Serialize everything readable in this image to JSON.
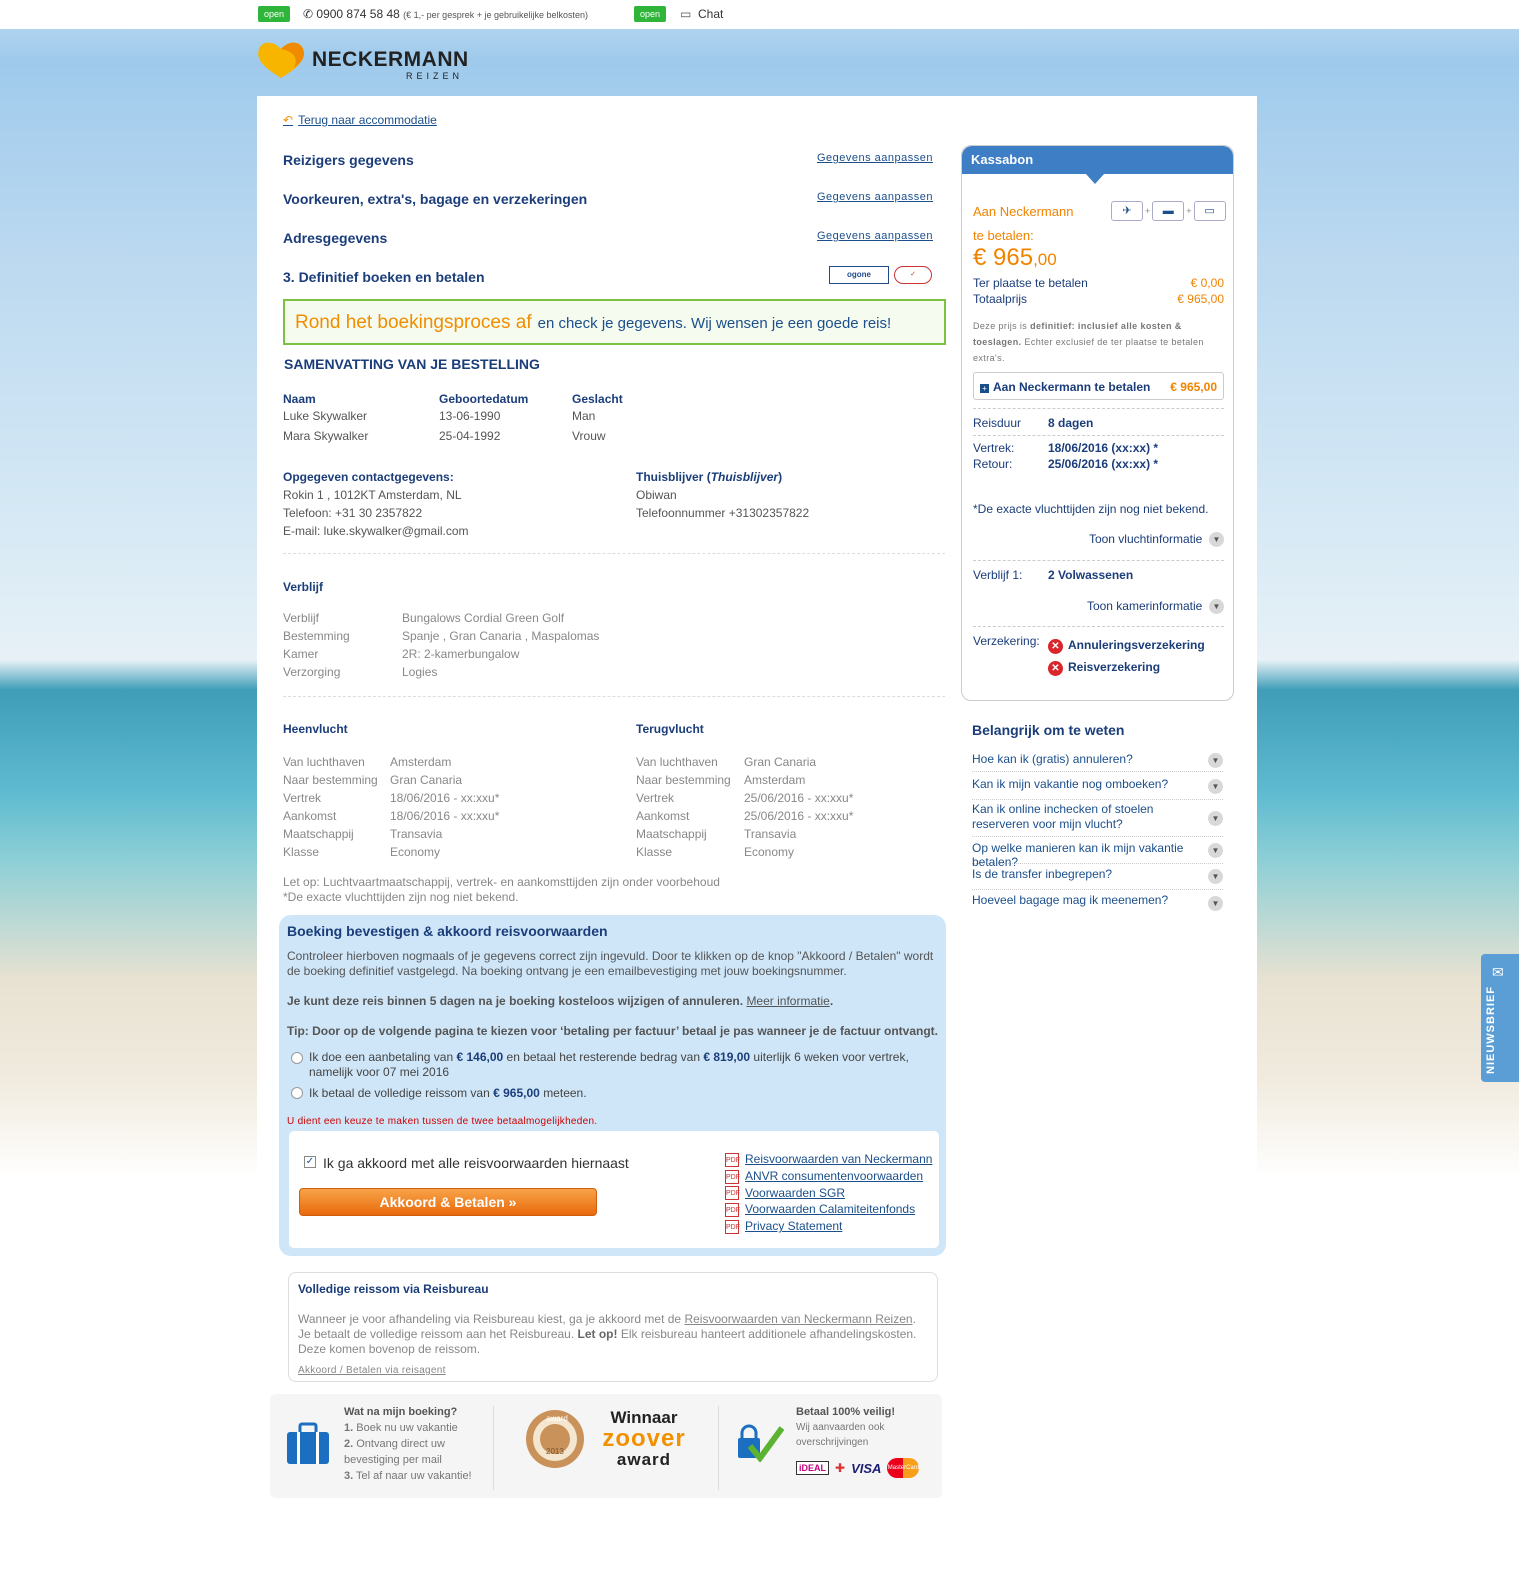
{
  "topbar": {
    "open1": "open",
    "phone": "0900 874 58 48",
    "phone_note": "(€ 1,- per gesprek + je gebruikelijke belkosten)",
    "open2": "open",
    "chat": "Chat"
  },
  "brand": {
    "name": "NECKERMANN",
    "sub": "REIZEN"
  },
  "back_link": "Terug naar accommodatie",
  "steps": [
    {
      "title": "Reizigers gegevens",
      "edit": "Gegevens aanpassen"
    },
    {
      "title": "Voorkeuren, extra's, bagage en verzekeringen",
      "edit": "Gegevens aanpassen"
    },
    {
      "title": "Adresgegevens",
      "edit": "Gegevens aanpassen"
    },
    {
      "title": "3. Definitief boeken en betalen"
    }
  ],
  "ogone": "ogone",
  "banner": {
    "big": "Rond het boekingsproces af",
    "small": "en check je gegevens. Wij wensen je een goede reis!"
  },
  "summary": {
    "title": "SAMENVATTING VAN JE BESTELLING",
    "cols": [
      "Naam",
      "Geboortedatum",
      "Geslacht"
    ],
    "travelers": [
      [
        "Luke Skywalker",
        "13-06-1990",
        "Man"
      ],
      [
        "Mara Skywalker",
        "25-04-1992",
        "Vrouw"
      ]
    ],
    "contact_title": "Opgegeven contactgegevens:",
    "contact": [
      "Rokin 1 , 1012KT Amsterdam, NL",
      "Telefoon: +31 30 2357822",
      "E-mail: luke.skywalker@gmail.com"
    ],
    "home_title": "Thuisblijver",
    "home_italic": "Thuisblijver",
    "home": [
      "Obiwan",
      "Telefoonnummer +31302357822"
    ]
  },
  "stay": {
    "title": "Verblijf",
    "rows": [
      [
        "Verblijf",
        "Bungalows Cordial Green Golf"
      ],
      [
        "Bestemming",
        "Spanje , Gran Canaria , Maspalomas"
      ],
      [
        "Kamer",
        "2R: 2-kamerbungalow"
      ],
      [
        "Verzorging",
        "Logies"
      ]
    ]
  },
  "flights": {
    "out_title": "Heenvlucht",
    "ret_title": "Terugvlucht",
    "labels": [
      "Van luchthaven",
      "Naar bestemming",
      "Vertrek",
      "Aankomst",
      "Maatschappij",
      "Klasse"
    ],
    "out": [
      "Amsterdam",
      "Gran Canaria",
      "18/06/2016 - xx:xxu*",
      "18/06/2016 - xx:xxu*",
      "Transavia",
      "Economy"
    ],
    "ret": [
      "Gran Canaria",
      "Amsterdam",
      "25/06/2016 - xx:xxu*",
      "25/06/2016 - xx:xxu*",
      "Transavia",
      "Economy"
    ],
    "note1": "Let op: Luchtvaartmaatschappij, vertrek- en aankomsttijden zijn onder voorbehoud",
    "note2": "*De exacte vluchttijden zijn nog niet bekend."
  },
  "confirm": {
    "title": "Boeking bevestigen & akkoord reisvoorwaarden",
    "p1": "Controleer hierboven nogmaals of je gegevens correct zijn ingevuld. Door te klikken op de knop \"Akkoord / Betalen\" wordt de boeking definitief vastgelegd. Na boeking ontvang je een emailbevestiging met jouw boekingsnummer.",
    "p2": "Je kunt deze reis binnen 5 dagen na je boeking kosteloos wijzigen of annuleren.",
    "p2_link": "Meer informatie",
    "p3": "Tip: Door op de volgende pagina te kiezen voor ‘betaling per factuur’ betaal je pas wanneer je de factuur ontvangt.",
    "opt1_a": "Ik doe een aanbetaling van",
    "opt1_amt": "€ 146,00",
    "opt1_b": "en betaal het resterende bedrag van",
    "opt1_amt2": "€ 819,00",
    "opt1_c": "uiterlijk 6 weken voor vertrek,",
    "opt1_d": "namelijk voor  07 mei 2016",
    "opt2_a": "Ik betaal de volledige reissom van",
    "opt2_amt": "€ 965,00",
    "opt2_b": "meteen.",
    "error": "U dient een keuze te maken tussen de twee betaalmogelijkheden.",
    "agree": "Ik ga akkoord met alle reisvoorwaarden hiernaast",
    "button": "Akkoord & Betalen  »",
    "pdfs": [
      "Reisvoorwaarden van Neckermann",
      "ANVR consumentenvoorwaarden",
      "Voorwaarden SGR",
      "Voorwaarden Calamiteitenfonds",
      "Privacy Statement"
    ]
  },
  "travel_agent": {
    "title": "Volledige reissom via Reisbureau",
    "p_a": "Wanneer je voor afhandeling via Reisbureau kiest, ga je akkoord met de",
    "p_link": "Reisvoorwaarden van Neckermann Reizen",
    "p_b": ". Je betaalt de volledige reissom aan het Reisbureau.",
    "p_bold": "Let op!",
    "p_c": "Elk reisbureau hanteert additionele afhandelingskosten. Deze komen bovenop de reissom.",
    "link": "Akkoord / Betalen via reisagent"
  },
  "footer": {
    "what_title": "Wat na mijn boeking?",
    "steps": [
      "Boek nu uw vakantie",
      "Ontvang direct uw bevestiging per mail",
      "Tel af naar uw vakantie!"
    ],
    "award_winner": "Winnaar",
    "award_name": "zoover",
    "award_word": "award",
    "award_year": "2013",
    "award_badge": "award",
    "safe_title": "Betaal 100% veilig!",
    "safe_text": "Wij aanvaarden ook overschrijvingen",
    "payments": [
      "iDEAL",
      "VISA",
      "MasterCard"
    ]
  },
  "kassabon": {
    "title": "Kassabon",
    "pay_label1": "Aan Neckermann",
    "pay_label2": "te betalen:",
    "price_main": "€ 965",
    "price_cents": ",00",
    "onsite_label": "Ter plaatse te betalen",
    "onsite_val": "€ 0,00",
    "total_label": "Totaalprijs",
    "total_val": "€ 965,00",
    "note_a": "Deze prijs is",
    "note_bold": "definitief: inclusief alle kosten & toeslagen.",
    "note_b": "Echter exclusief de ter plaatse te betalen extra's.",
    "box_label": "Aan Neckermann te betalen",
    "box_val": "€ 965,00",
    "duration_label": "Reisduur",
    "duration_val": "8 dagen",
    "dep_label": "Vertrek:",
    "dep_val": "18/06/2016 (xx:xx) *",
    "ret_label": "Retour:",
    "ret_val": "25/06/2016 (xx:xx) *",
    "flight_note": "*De exacte vluchttijden zijn nog niet bekend.",
    "show_flight": "Toon vluchtinformatie",
    "stay_label": "Verblijf 1:",
    "stay_val": "2 Volwassenen",
    "show_room": "Toon kamerinformatie",
    "ins_label": "Verzekering:",
    "ins1": "Annuleringsverzekering",
    "ins2": "Reisverzekering"
  },
  "important": {
    "title": "Belangrijk om te weten",
    "items": [
      "Hoe kan ik (gratis) annuleren?",
      "Kan ik mijn vakantie nog omboeken?",
      "Kan ik online inchecken of stoelen reserveren voor mijn vlucht?",
      "Op welke manieren kan ik mijn vakantie betalen?",
      "Is de transfer inbegrepen?",
      "Hoeveel bagage mag ik meenemen?"
    ]
  },
  "newsletter": "NIEUWSBRIEF",
  "colors": {
    "brand_blue": "#1b3d7a",
    "accent_orange": "#f08300",
    "green": "#7cc242",
    "kassa_blue": "#3d7ec5"
  }
}
